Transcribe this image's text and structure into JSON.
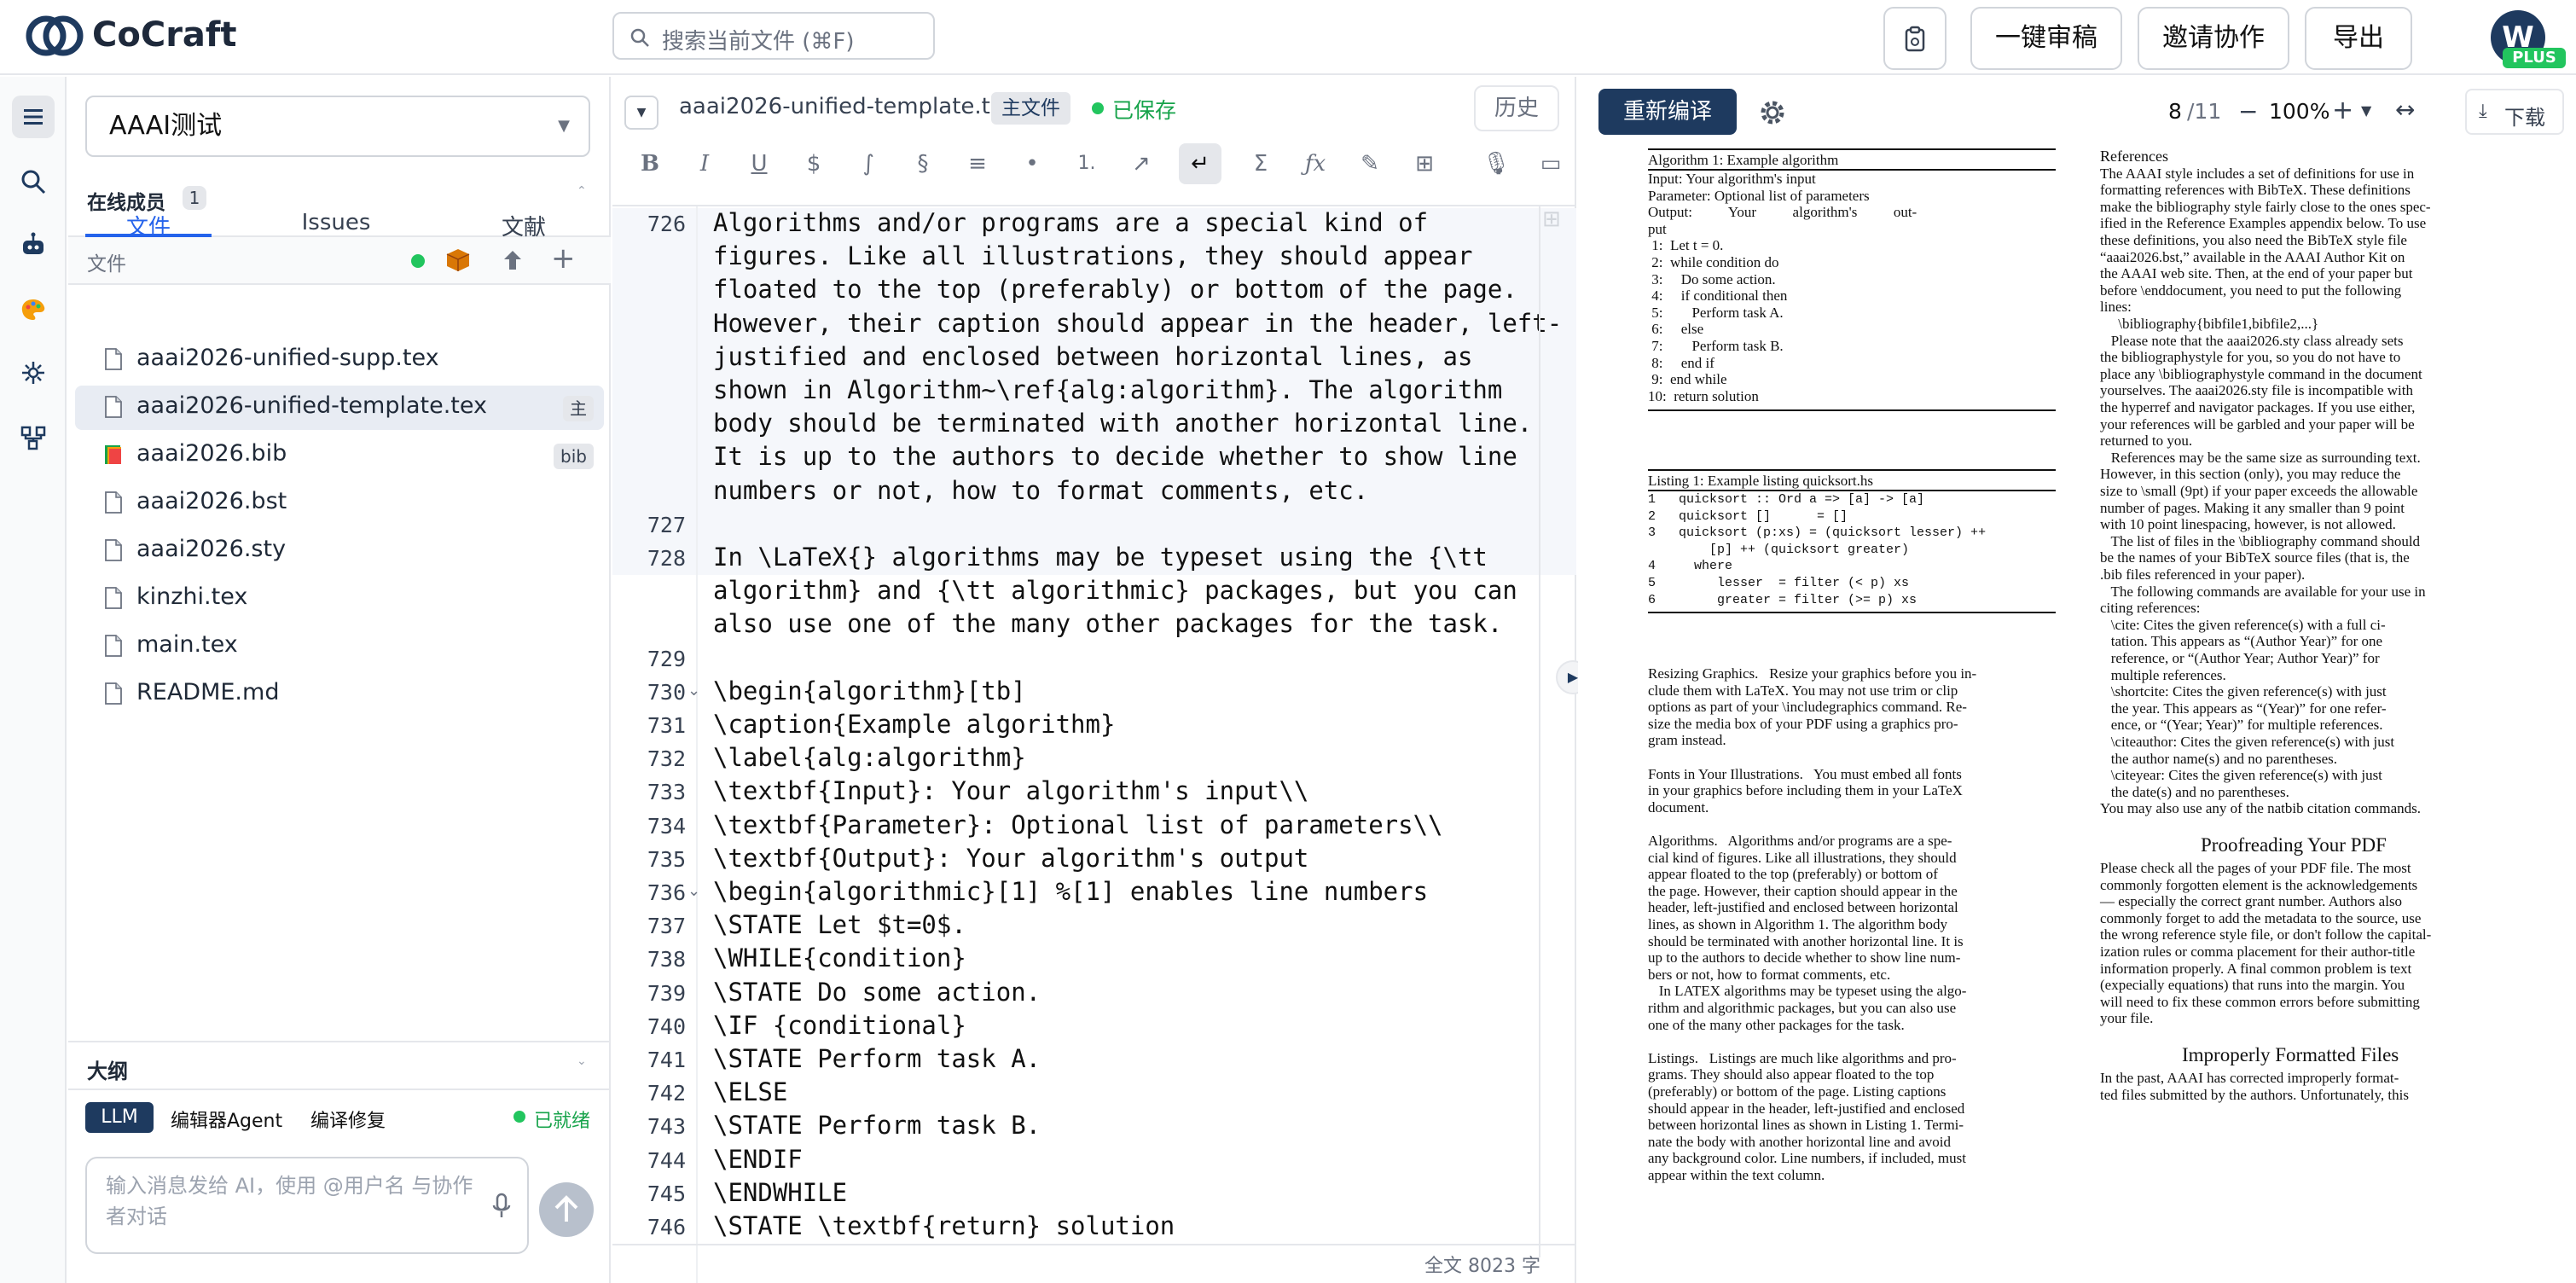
{
  "app": {
    "name": "CoCraft"
  },
  "search": {
    "placeholder": "搜索当前文件 (⌘F)"
  },
  "top_actions": {
    "review": "一键审稿",
    "invite": "邀请协作",
    "export": "导出"
  },
  "user": {
    "initial": "W",
    "plan": "PLUS"
  },
  "project": {
    "name": "AAAI测试"
  },
  "members": {
    "label": "在线成员",
    "count": "1"
  },
  "left_tabs": [
    "文件",
    "Issues",
    "文献"
  ],
  "files_header": "文件",
  "files": [
    {
      "name": "aaai2026-unified-supp.tex",
      "tag": ""
    },
    {
      "name": "aaai2026-unified-template.tex",
      "tag": "主"
    },
    {
      "name": "aaai2026.bib",
      "tag": "bib"
    },
    {
      "name": "aaai2026.bst",
      "tag": ""
    },
    {
      "name": "aaai2026.sty",
      "tag": ""
    },
    {
      "name": "kinzhi.tex",
      "tag": ""
    },
    {
      "name": "main.tex",
      "tag": ""
    },
    {
      "name": "README.md",
      "tag": ""
    }
  ],
  "outline": {
    "label": "大纲"
  },
  "ai": {
    "tabs": [
      "LLM",
      "编辑器Agent",
      "编译修复"
    ],
    "status": "已就绪",
    "placeholder": "输入消息发给 AI，使用 @用户名 与协作者对话"
  },
  "editor": {
    "filename": "aaai2026-unified-template.tex",
    "main_badge": "主文件",
    "saved": "已保存",
    "history": "历史",
    "word_count": "全文 8023 字",
    "lines": [
      {
        "n": "726",
        "text": "Algorithms and/or programs are a special kind of"
      },
      {
        "n": "",
        "text": "figures. Like all illustrations, they should appear"
      },
      {
        "n": "",
        "text": "floated to the top (preferably) or bottom of the page."
      },
      {
        "n": "",
        "text": "However, their caption should appear in the header, left-"
      },
      {
        "n": "",
        "text": "justified and enclosed between horizontal lines, as"
      },
      {
        "n": "",
        "text": "shown in Algorithm~\\ref{alg:algorithm}. The algorithm"
      },
      {
        "n": "",
        "text": "body should be terminated with another horizontal line."
      },
      {
        "n": "",
        "text": "It is up to the authors to decide whether to show line"
      },
      {
        "n": "",
        "text": "numbers or not, how to format comments, etc."
      },
      {
        "n": "727",
        "text": ""
      },
      {
        "n": "728",
        "text": "In \\LaTeX{} algorithms may be typeset using the {\\tt"
      },
      {
        "n": "",
        "text": "algorithm} and {\\tt algorithmic} packages, but you can"
      },
      {
        "n": "",
        "text": "also use one of the many other packages for the task."
      },
      {
        "n": "729",
        "text": ""
      },
      {
        "n": "730",
        "text": "\\begin{algorithm}[tb]"
      },
      {
        "n": "731",
        "text": "\\caption{Example algorithm}"
      },
      {
        "n": "732",
        "text": "\\label{alg:algorithm}"
      },
      {
        "n": "733",
        "text": "\\textbf{Input}: Your algorithm's input\\\\"
      },
      {
        "n": "734",
        "text": "\\textbf{Parameter}: Optional list of parameters\\\\"
      },
      {
        "n": "735",
        "text": "\\textbf{Output}: Your algorithm's output"
      },
      {
        "n": "736",
        "text": "\\begin{algorithmic}[1] %[1] enables line numbers"
      },
      {
        "n": "737",
        "text": "\\STATE Let $t=0$."
      },
      {
        "n": "738",
        "text": "\\WHILE{condition}"
      },
      {
        "n": "739",
        "text": "\\STATE Do some action."
      },
      {
        "n": "740",
        "text": "\\IF {conditional}"
      },
      {
        "n": "741",
        "text": "\\STATE Perform task A."
      },
      {
        "n": "742",
        "text": "\\ELSE"
      },
      {
        "n": "743",
        "text": "\\STATE Perform task B."
      },
      {
        "n": "744",
        "text": "\\ENDIF"
      },
      {
        "n": "745",
        "text": "\\ENDWHILE"
      },
      {
        "n": "746",
        "text": "\\STATE \\textbf{return} solution"
      }
    ]
  },
  "pdf": {
    "recompile": "重新编译",
    "page": "8",
    "total": "/11",
    "zoom": "100%",
    "download": "下载",
    "left_col": [
      "Algorithm 1: Example algorithm",
      "Input: Your algorithm's input",
      "Parameter: Optional list of parameters",
      "Output:          Your          algorithm's          out-",
      "put",
      " 1:  Let t = 0.",
      " 2:  while condition do",
      " 3:     Do some action.",
      " 4:     if conditional then",
      " 5:        Perform task A.",
      " 6:     else",
      " 7:        Perform task B.",
      " 8:     end if",
      " 9:  end while",
      "10:  return solution"
    ],
    "listing": [
      "Listing 1: Example listing quicksort.hs",
      "1   quicksort :: Ord a => [a] -> [a]",
      "2   quicksort []      = []",
      "3   quicksort (p:xs) = (quicksort lesser) ++",
      "        [p] ++ (quicksort greater)",
      "4     where",
      "5        lesser  = filter (< p) xs",
      "6        greater = filter (>= p) xs"
    ],
    "left_body": [
      "Resizing Graphics.   Resize your graphics before you in-",
      "clude them with LaTeX. You may not use trim or clip",
      "options as part of your \\includegraphics command. Re-",
      "size the media box of your PDF using a graphics pro-",
      "gram instead.",
      "",
      "Fonts in Your Illustrations.   You must embed all fonts",
      "in your graphics before including them in your LaTeX",
      "document.",
      "",
      "Algorithms.   Algorithms and/or programs are a spe-",
      "cial kind of figures. Like all illustrations, they should",
      "appear floated to the top (preferably) or bottom of",
      "the page. However, their caption should appear in the",
      "header, left-justified and enclosed between horizontal",
      "lines, as shown in Algorithm 1. The algorithm body",
      "should be terminated with another horizontal line. It is",
      "up to the authors to decide whether to show line num-",
      "bers or not, how to format comments, etc.",
      "   In LATEX algorithms may be typeset using the algo-",
      "rithm and algorithmic packages, but you can also use",
      "one of the many other packages for the task.",
      "",
      "Listings.   Listings are much like algorithms and pro-",
      "grams. They should also appear floated to the top",
      "(preferably) or bottom of the page. Listing captions",
      "should appear in the header, left-justified and enclosed",
      "between horizontal lines as shown in Listing 1. Termi-",
      "nate the body with another horizontal line and avoid",
      "any background color. Line numbers, if included, must",
      "appear within the text column."
    ],
    "right_body": [
      "References",
      "The AAAI style includes a set of definitions for use in",
      "formatting references with BibTeX. These definitions",
      "make the bibliography style fairly close to the ones spec-",
      "ified in the Reference Examples appendix below. To use",
      "these definitions, you also need the BibTeX style file",
      "“aaai2026.bst,” available in the AAAI Author Kit on",
      "the AAAI web site. Then, at the end of your paper but",
      "before \\enddocument, you need to put the following",
      "lines:",
      "     \\bibliography{bibfile1,bibfile2,...}",
      "   Please note that the aaai2026.sty class already sets",
      "the bibliographystyle for you, so you do not have to",
      "place any \\bibliographystyle command in the document",
      "yourselves. The aaai2026.sty file is incompatible with",
      "the hyperref and navigator packages. If you use either,",
      "your references will be garbled and your paper will be",
      "returned to you.",
      "   References may be the same size as surrounding text.",
      "However, in this section (only), you may reduce the",
      "size to \\small (9pt) if your paper exceeds the allowable",
      "number of pages. Making it any smaller than 9 point",
      "with 10 point linespacing, however, is not allowed.",
      "   The list of files in the \\bibliography command should",
      "be the names of your BibTeX source files (that is, the",
      ".bib files referenced in your paper).",
      "   The following commands are available for your use in",
      "citing references:",
      "   \\cite: Cites the given reference(s) with a full ci-",
      "   tation. This appears as “(Author Year)” for one",
      "   reference, or “(Author Year; Author Year)” for",
      "   multiple references.",
      "   \\shortcite: Cites the given reference(s) with just",
      "   the year. This appears as “(Year)” for one refer-",
      "   ence, or “(Year; Year)” for multiple references.",
      "   \\citeauthor: Cites the given reference(s) with just",
      "   the author name(s) and no parentheses.",
      "   \\citeyear: Cites the given reference(s) with just",
      "   the date(s) and no parentheses.",
      "You may also use any of the natbib citation commands."
    ],
    "proof_title": "Proofreading Your PDF",
    "proof_body": [
      "Please check all the pages of your PDF file. The most",
      "commonly forgotten element is the acknowledgements",
      "— especially the correct grant number. Authors also",
      "commonly forget to add the metadata to the source, use",
      "the wrong reference style file, or don't follow the capital-",
      "ization rules or comma placement for their author-title",
      "information properly. A final common problem is text",
      "(expecially equations) that runs into the margin. You",
      "will need to fix these common errors before submitting",
      "your file."
    ],
    "improper_title": "Improperly Formatted Files",
    "improper_body": [
      "In the past, AAAI has corrected improperly format-",
      "ted files submitted by the authors. Unfortunately, this"
    ]
  }
}
